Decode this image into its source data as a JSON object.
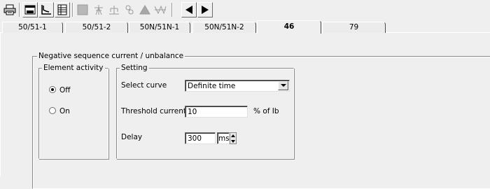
{
  "toolbar": {
    "icons": [
      "printer-icon",
      "window-icon",
      "curve-chart-icon",
      "table-icon",
      "grid-icon",
      "tower-icon",
      "tree-icon",
      "link-icon",
      "triangle-icon",
      "waveform-icon",
      "arrow-left-icon",
      "arrow-right-icon"
    ]
  },
  "tabs": [
    {
      "label": "50/51-1"
    },
    {
      "label": "50/51-2"
    },
    {
      "label": "50N/51N-1"
    },
    {
      "label": "50N/51N-2"
    },
    {
      "label": "46",
      "active": true
    },
    {
      "label": "79"
    }
  ],
  "main_group": {
    "title": "Negative sequence current / unbalance"
  },
  "element_activity": {
    "title": "Element activity",
    "options": [
      {
        "label": "Off",
        "selected": true
      },
      {
        "label": "On",
        "selected": false
      }
    ]
  },
  "setting": {
    "title": "Setting",
    "select_curve_label": "Select curve",
    "select_curve_value": "Definite time",
    "threshold_label": "Threshold current",
    "threshold_value": "10",
    "threshold_unit": "% of Ib",
    "delay_label": "Delay",
    "delay_value": "300",
    "delay_unit": "ms"
  }
}
